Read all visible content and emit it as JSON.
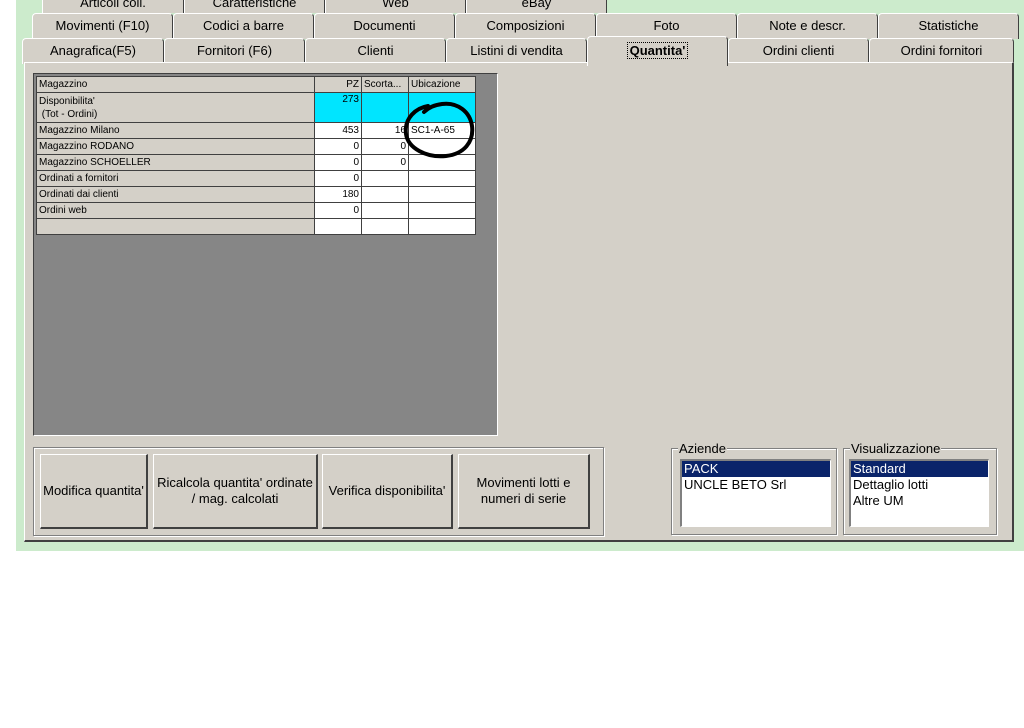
{
  "tabs_row1": [
    "Articoli coll.",
    "Caratteristiche",
    "Web",
    "eBay"
  ],
  "tabs_row2": [
    "Movimenti (F10)",
    "Codici a barre",
    "Documenti",
    "Composizioni",
    "Foto",
    "Note e descr.",
    "Statistiche"
  ],
  "tabs_row3": [
    "Anagrafica(F5)",
    "Fornitori (F6)",
    "Clienti",
    "Listini di vendita",
    "Quantita'",
    "Ordini clienti",
    "Ordini fornitori"
  ],
  "grid": {
    "headers": [
      "Magazzino",
      "PZ",
      "Scorta...",
      "Ubicazione"
    ],
    "rows": [
      {
        "label_line1": "Disponibilita'",
        "label_line2": " (Tot - Ordini)",
        "pz": "273",
        "scorta": "",
        "ubicazione": ""
      },
      {
        "label": "Magazzino Milano",
        "pz": "453",
        "scorta": "16",
        "ubicazione": "SC1-A-65"
      },
      {
        "label": "Magazzino RODANO",
        "pz": "0",
        "scorta": "0",
        "ubicazione": ""
      },
      {
        "label": "Magazzino SCHOELLER",
        "pz": "0",
        "scorta": "0",
        "ubicazione": ""
      },
      {
        "label": "Ordinati a fornitori",
        "pz": "0",
        "scorta": "",
        "ubicazione": ""
      },
      {
        "label": "Ordinati dai clienti",
        "pz": "180",
        "scorta": "",
        "ubicazione": ""
      },
      {
        "label": "Ordini web",
        "pz": "0",
        "scorta": "",
        "ubicazione": ""
      },
      {
        "label": "",
        "pz": "",
        "scorta": "",
        "ubicazione": ""
      }
    ]
  },
  "buttons": {
    "modifica": "Modifica quantita'",
    "ricalcola": "Ricalcola quantita' ordinate / mag. calcolati",
    "verifica": "Verifica disponibilita'",
    "movimenti": "Movimenti lotti e numeri di serie"
  },
  "aziende": {
    "label": "Aziende",
    "items": [
      "PACK",
      "UNCLE BETO Srl"
    ],
    "selected": "PACK"
  },
  "visualizzazione": {
    "label": "Visualizzazione",
    "items": [
      "Standard",
      "Dettaglio lotti",
      "Altre UM"
    ],
    "selected": "Standard"
  },
  "colors": {
    "window_bg": "#d4d0c8",
    "highlight_cell": "#00e5ff",
    "selection": "#0a246a",
    "frame_green": "#ccebcc"
  },
  "annotation": {
    "icon": "hand-drawn-circle"
  }
}
